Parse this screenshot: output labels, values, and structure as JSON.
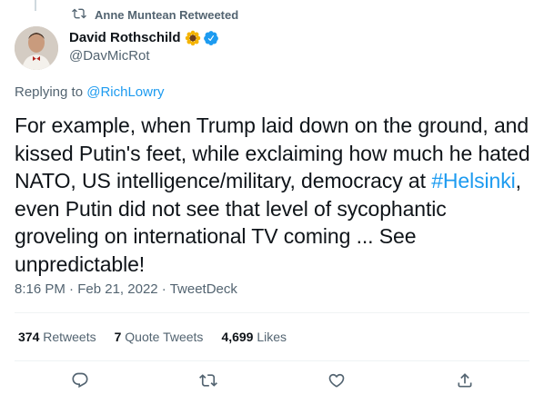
{
  "retweet_context": {
    "text": "Anne Muntean Retweeted",
    "icon": "retweet-icon"
  },
  "author": {
    "name": "David Rothschild",
    "emoji": "sunflower",
    "verified": true,
    "handle": "@DavMicRot"
  },
  "reply": {
    "prefix": "Replying to ",
    "target": "@RichLowry"
  },
  "tweet": {
    "text_before_hashtag": "For example, when Trump laid down on the ground, and kissed Putin's feet, while exclaiming how much he hated NATO, US intelligence/military, democracy at ",
    "hashtag": "#Helsinki",
    "text_after_hashtag": ", even Putin did not see that level of sycophantic groveling on international TV coming ... See unpredictable!"
  },
  "meta": {
    "time": "8:16 PM",
    "sep1": " · ",
    "date": "Feb 21, 2022",
    "sep2": " · ",
    "source": "TweetDeck"
  },
  "stats": {
    "retweets_count": "374",
    "retweets_label": "Retweets",
    "quotes_count": "7",
    "quotes_label": "Quote Tweets",
    "likes_count": "4,699",
    "likes_label": "Likes"
  },
  "actions": [
    "reply-icon",
    "retweet-icon",
    "like-icon",
    "share-icon"
  ],
  "colors": {
    "link": "#1d9bf0",
    "secondary": "#536471",
    "primary": "#0f1419",
    "divider": "#eff3f4"
  }
}
